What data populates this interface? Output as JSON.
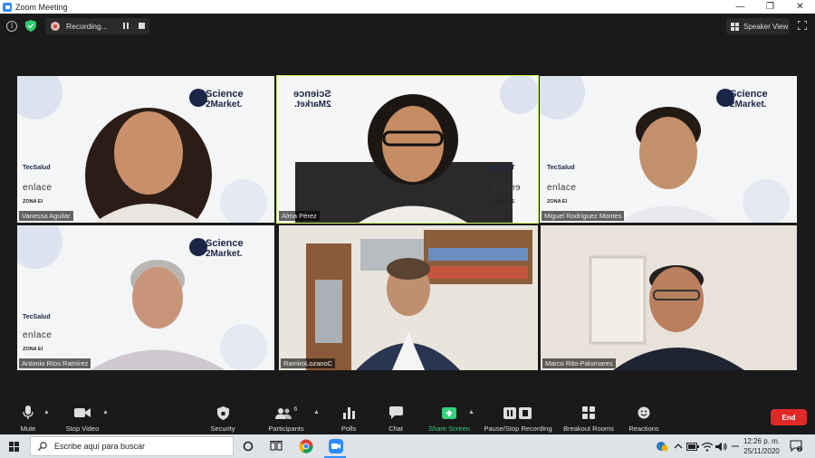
{
  "window": {
    "title": "Zoom Meeting"
  },
  "topbar": {
    "recording_label": "Recording...",
    "speaker_view_label": "Speaker View"
  },
  "participants": [
    {
      "name": "Vanessa Aguilar"
    },
    {
      "name": "Alma Pérez",
      "active": true
    },
    {
      "name": "Miguel Rodríguez Montes"
    },
    {
      "name": "Antonio Ríos Ramírez"
    },
    {
      "name": "RamiroLozanoC"
    },
    {
      "name": "Marco Rito-Palomares"
    }
  ],
  "branding": {
    "science": "Science",
    "market": "2Market.",
    "tecsalud": "TecSalud",
    "enlace": "enlace",
    "zona": "ZONA EI"
  },
  "toolbar": {
    "mute": "Mute",
    "stop_video": "Stop Video",
    "security": "Security",
    "participants": "Participants",
    "participants_count": "6",
    "polls": "Polls",
    "chat": "Chat",
    "share_screen": "Share Screen",
    "pause_stop_recording": "Pause/Stop Recording",
    "breakout_rooms": "Breakout Rooms",
    "reactions": "Reactions",
    "end": "End"
  },
  "taskbar": {
    "search_placeholder": "Escribe aquí para buscar",
    "time": "12:26 p. m.",
    "date": "25/11/2020",
    "notification_count": "2"
  },
  "colors": {
    "active_speaker_border": "#c9f364",
    "end_button": "#e02828",
    "share_screen": "#33d17a",
    "zoom_blue": "#2d8cff"
  }
}
